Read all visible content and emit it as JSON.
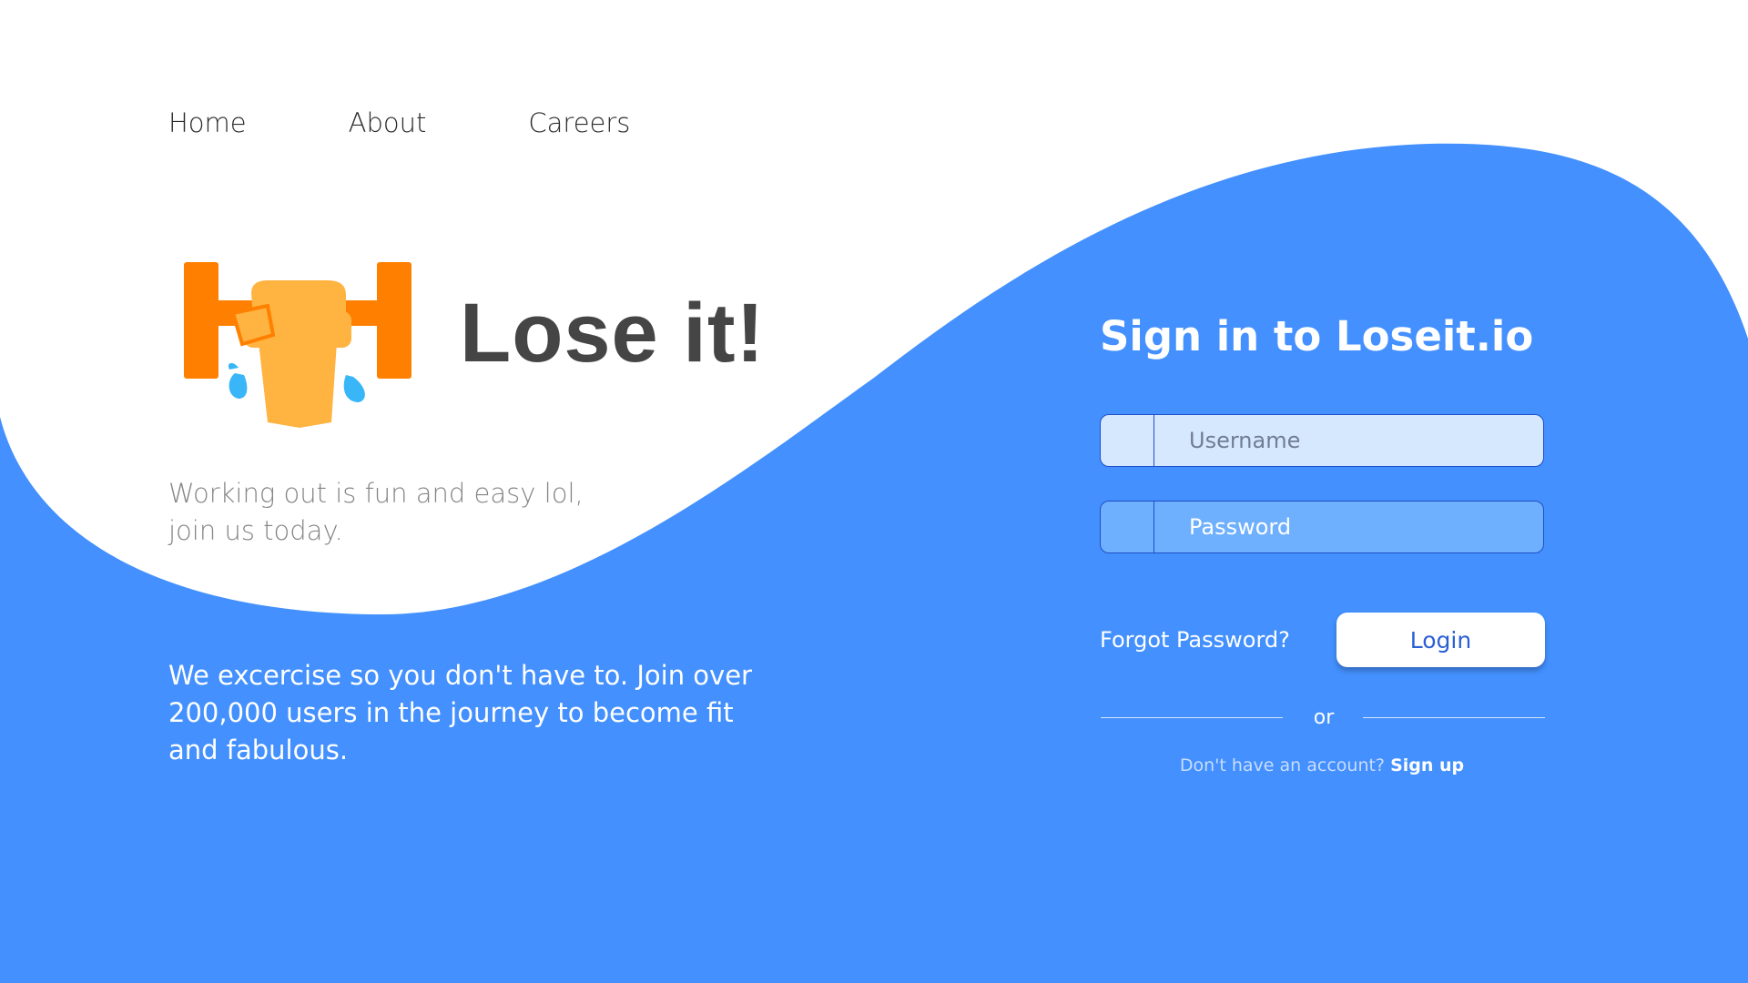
{
  "nav": {
    "items": [
      "Home",
      "About",
      "Careers"
    ]
  },
  "brand": {
    "title": "Lose it!",
    "logo_icon": "weightlifting-icon"
  },
  "hero": {
    "tagline": "Working out is fun and easy lol, join us today.",
    "description": "We excercise so you don't have to. Join over 200,000 users in the journey to become fit and fabulous."
  },
  "signin": {
    "title": "Sign in to Loseit.io",
    "username_placeholder": "Username",
    "password_placeholder": "Password",
    "forgot_label": "Forgot Password?",
    "login_label": "Login",
    "or_label": "or",
    "no_account_text": "Don't have an account?",
    "signup_label": "Sign up"
  },
  "colors": {
    "primary_blue": "#4390fe",
    "logo_orange": "#ff8000",
    "logo_light_orange": "#ffb340",
    "logo_sweat": "#38b6f8",
    "text_dark": "#454545",
    "button_text": "#2b5fd6"
  }
}
